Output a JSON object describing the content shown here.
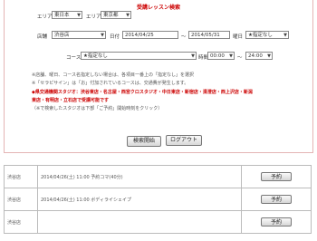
{
  "search": {
    "title": "受講レッスン検索",
    "area_label": "エリア",
    "area_value": "東日本",
    "pref_label": "エリア",
    "pref_value": "東京都",
    "store_label": "店舗",
    "store_value": "渋谷店",
    "date_label": "日付",
    "date_from": "2014/04/25",
    "date_sep": "〜",
    "date_to": "2014/05/31",
    "weekday_label": "曜日",
    "weekday_value": "★指定なし",
    "course_label": "コース",
    "course_value": "★指定なし",
    "time_label": "時間",
    "time_from": "00:00",
    "time_sep": "〜",
    "time_to": "24:00",
    "notes": [
      "※店舗、曜日、コース名指定しない場合は、各項目一番上の「指定なし」を選択",
      "※「セラピサイン」は「お」付加されているコースは、交通費が発生します。",
      "◆県交通機関スタジオ：渋谷東店・名古屋・西宮クロスタジオ・中日東店・新宿店・清澄店・西上沢店・新潟",
      "東店・有明店・立石店で受講可能です",
      "（※で検索したスタジオは下部「ご予約」開始時刻をクリック）"
    ],
    "search_button": "検索開始",
    "logout_button": "ログアウト"
  },
  "results": [
    {
      "store": "渋谷店",
      "lesson": "2014/04/26(土) 11:00  予約コマ(40分)",
      "action": "予約"
    },
    {
      "store": "渋谷店",
      "lesson": "2014/04/26(土) 11:00  ボディライシェイプ",
      "action": "予約"
    },
    {
      "store": "渋谷店",
      "lesson": "",
      "action": "予約"
    }
  ]
}
